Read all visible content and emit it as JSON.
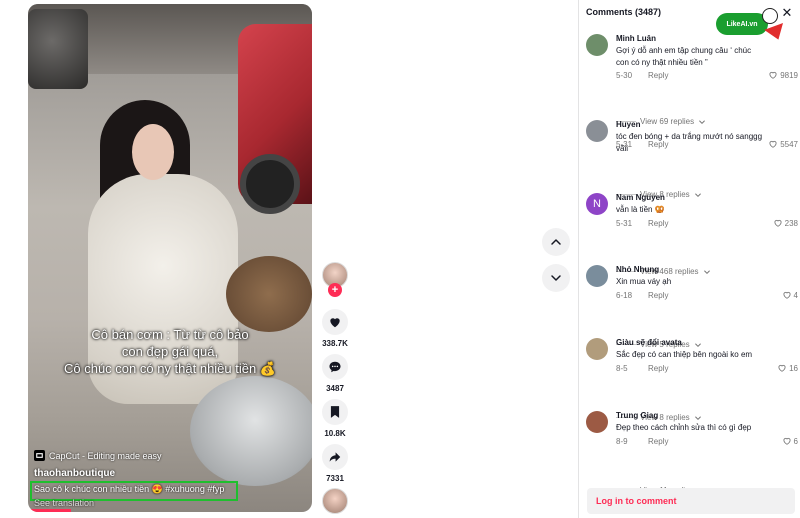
{
  "video": {
    "overlay_line1": "Cô bán cơm : Từ từ cô bảo",
    "overlay_line2": "con đẹp gái quá,",
    "overlay_line3": "Cô chúc con có ny thật nhiều tiền 💰",
    "capcut_label": "CapCut - Editing made easy",
    "author": "thaohanboutique",
    "caption": "Sao cô k chúc con nhiều tiền 😍 #xuhuong #fyp",
    "see_translation": "See translation",
    "progress_fraction": 0.15
  },
  "actions": {
    "likes": "338.7K",
    "comments": "3487",
    "saves": "10.8K",
    "shares": "7331",
    "follow_symbol": "+"
  },
  "panel": {
    "header": "Comments (3487)",
    "close_symbol": "✕",
    "logo_text": "LikeAI.vn",
    "login": "Log in to comment"
  },
  "comments": [
    {
      "name": "Minh Luân",
      "text": "Gợi ý dỗ anh em tập chung câu ‘ chúc con có ny thật nhiều tiền ”",
      "date": "5-30",
      "reply": "Reply",
      "likes": "9819",
      "view_replies": "View 69 replies",
      "avatar_color": "#6e8e6a",
      "avatar_letter": ""
    },
    {
      "name": "Huyen",
      "text": "tóc đen bóng + da trắng mướt nó sanggg vãii",
      "date": "5-31",
      "reply": "Reply",
      "likes": "5547",
      "view_replies": "View 8 replies",
      "avatar_color": "#8a8f96",
      "avatar_letter": ""
    },
    {
      "name": "Nam Nguyen",
      "text": "vẫn là tiền 🥨",
      "date": "5-31",
      "reply": "Reply",
      "likes": "238",
      "view_replies": "View 468 replies",
      "avatar_color": "#8e44c7",
      "avatar_letter": "N"
    },
    {
      "name": "Nhỏ Nhung",
      "text": "Xin mua váy ạh",
      "date": "6-18",
      "reply": "Reply",
      "likes": "4",
      "view_replies": "View 5 replies",
      "avatar_color": "#7a8d9c",
      "avatar_letter": ""
    },
    {
      "name": "Giàu sẽ đổi avata",
      "text": "Sắc đẹp có can thiệp bên ngoài ko em",
      "date": "8-5",
      "reply": "Reply",
      "likes": "16",
      "view_replies": "View 8 replies",
      "avatar_color": "#b19c7c",
      "avatar_letter": ""
    },
    {
      "name": "Trung Giag",
      "text": "Đẹp theo cách chỉnh sửa thì có gì đẹp",
      "date": "8-9",
      "reply": "Reply",
      "likes": "6",
      "view_replies": "View 11 replies",
      "avatar_color": "#9c5a44",
      "avatar_letter": ""
    }
  ]
}
